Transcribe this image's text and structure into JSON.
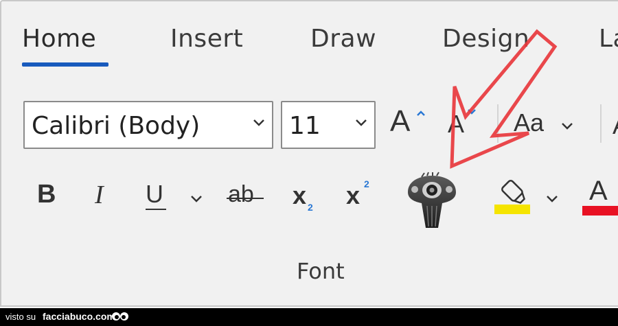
{
  "tabs": {
    "home": "Home",
    "insert": "Insert",
    "draw": "Draw",
    "design": "Design",
    "layout_partial": "La",
    "active": "Home"
  },
  "font_name": {
    "value": "Calibri (Body)"
  },
  "font_size": {
    "value": "11"
  },
  "buttons": {
    "grow_font": "A",
    "shrink_font": "A",
    "change_case": "Aa",
    "bold": "B",
    "italic": "I",
    "underline": "U",
    "strikethrough": "ab",
    "subscript_base": "x",
    "subscript_index": "2",
    "superscript_base": "x",
    "superscript_index": "2",
    "font_color": "A",
    "partial_right": "A"
  },
  "group_label": "Font",
  "footer": {
    "prefix": "visto su",
    "site": "facciabuco.com"
  },
  "colors": {
    "accent_blue": "#185abd",
    "highlight_yellow": "#f5e400",
    "font_color_red": "#e81123",
    "arrow_red": "#e8383d",
    "footer_bg": "#000000"
  },
  "icons": [
    "chevron-down-icon",
    "grow-font-icon",
    "shrink-font-icon",
    "highlighter-icon",
    "bird-skull-image",
    "red-arrow-annotation",
    "eyes-logo-icon"
  ]
}
